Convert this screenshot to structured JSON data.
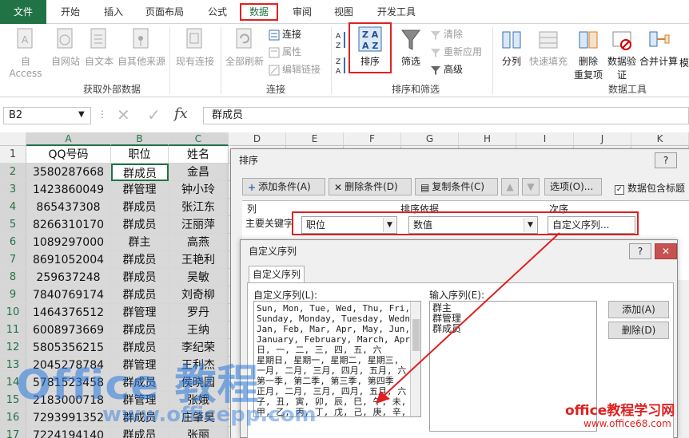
{
  "tabs": [
    "文件",
    "开始",
    "插入",
    "页面布局",
    "公式",
    "数据",
    "审阅",
    "视图",
    "开发工具"
  ],
  "ribbon": {
    "get_external": {
      "access": "自 Access",
      "web": "自网站",
      "text": "自文本",
      "other": "自其他来源",
      "label": "获取外部数据"
    },
    "existing": "现有连接",
    "refresh_all": "全部刷新",
    "connections": {
      "conn": "连接",
      "props": "属性",
      "edit_links": "编辑链接",
      "label": "连接"
    },
    "sort_filter": {
      "sort_az": "A↓Z",
      "sort": "排序",
      "filter": "筛选",
      "clear": "清除",
      "reapply": "重新应用",
      "advanced": "高级",
      "label": "排序和筛选"
    },
    "data_tools": {
      "split": "分列",
      "flash_fill": "快速填充",
      "remove_dup_1": "删除",
      "remove_dup_2": "重复项",
      "validation_1": "数据验",
      "validation_2": "证",
      "consolidate": "合并计算",
      "what_if": "模",
      "label": "数据工具"
    }
  },
  "formula_bar": {
    "name_box": "B2",
    "fx": "fx",
    "content": "群成员"
  },
  "columns": [
    "A",
    "B",
    "C",
    "D",
    "E",
    "F",
    "G",
    "H",
    "I",
    "J",
    "K"
  ],
  "rows": [
    "1",
    "2",
    "3",
    "4",
    "5",
    "6",
    "7",
    "8",
    "9",
    "10",
    "11",
    "12",
    "13",
    "14",
    "15",
    "16",
    "17"
  ],
  "table": {
    "headers": [
      "QQ号码",
      "职位",
      "姓名"
    ],
    "data": [
      [
        "3580287668",
        "群成员",
        "金昌"
      ],
      [
        "1423860049",
        "群管理",
        "钟小玲"
      ],
      [
        "865437308",
        "群成员",
        "张江东"
      ],
      [
        "8266310170",
        "群成员",
        "汪丽萍"
      ],
      [
        "1089297000",
        "群主",
        "高燕"
      ],
      [
        "8691052004",
        "群成员",
        "王艳利"
      ],
      [
        "259637248",
        "群成员",
        "吴敏"
      ],
      [
        "7840769174",
        "群成员",
        "刘奇柳"
      ],
      [
        "1464376512",
        "群管理",
        "罗丹"
      ],
      [
        "6008973669",
        "群成员",
        "王纳"
      ],
      [
        "5805356215",
        "群成员",
        "李纪荣"
      ],
      [
        "2045278784",
        "群管理",
        "王利杰"
      ],
      [
        "5781523458",
        "群成员",
        "侯晓园"
      ],
      [
        "2183000718",
        "群管理",
        "张娥"
      ],
      [
        "7293991352",
        "群成员",
        "庄肇昊"
      ],
      [
        "7224194140",
        "群成员",
        "张丽"
      ]
    ]
  },
  "sort_dialog": {
    "title": "排序",
    "help": "?",
    "add_condition": "添加条件(A)",
    "delete_condition": "删除条件(D)",
    "copy_condition": "复制条件(C)",
    "options": "选项(O)...",
    "has_headers": "数据包含标题",
    "col_header": "列",
    "sort_on_header": "排序依据",
    "order_header": "次序",
    "primary_key": "主要关键字",
    "column_value": "职位",
    "sort_on_value": "数值",
    "order_value": "自定义序列..."
  },
  "custom_dialog": {
    "title": "自定义序列",
    "help": "?",
    "close": "✕",
    "tab": "自定义序列",
    "list_label": "自定义序列(L):",
    "entries_label": "输入序列(E):",
    "lists": [
      "Sun, Mon, Tue, Wed, Thu, Fri, S",
      "Sunday, Monday, Tuesday, Wednes",
      "Jan, Feb, Mar, Apr, May, Jun, J",
      "January, February, March, April",
      "日, 一, 二, 三, 四, 五, 六",
      "星期日, 星期一, 星期二, 星期三,",
      "一月, 二月, 三月, 四月, 五月, 六",
      "第一季, 第二季, 第三季, 第四季",
      "正月, 二月, 三月, 四月, 五月, 六",
      "子, 丑, 寅, 卯, 辰, 巳, 午, 未,",
      "甲, 乙, 丙, 丁, 戊, 己, 庚, 辛,",
      "群主, 群管理, 群成员"
    ],
    "entries": [
      "群主",
      "群管理",
      "群成员"
    ],
    "add": "添加(A)",
    "delete": "删除(D)",
    "bottom_partial": "一 华 ... 从列表中导入"
  },
  "watermark": {
    "office": "Office 教程",
    "url": "www.officepp.com",
    "brand": "office教程学习网",
    "brand_url": "www.office68.com"
  },
  "colors": {
    "excel_green": "#217346",
    "highlight_red": "#e02020",
    "select_blue": "#3399ff"
  }
}
